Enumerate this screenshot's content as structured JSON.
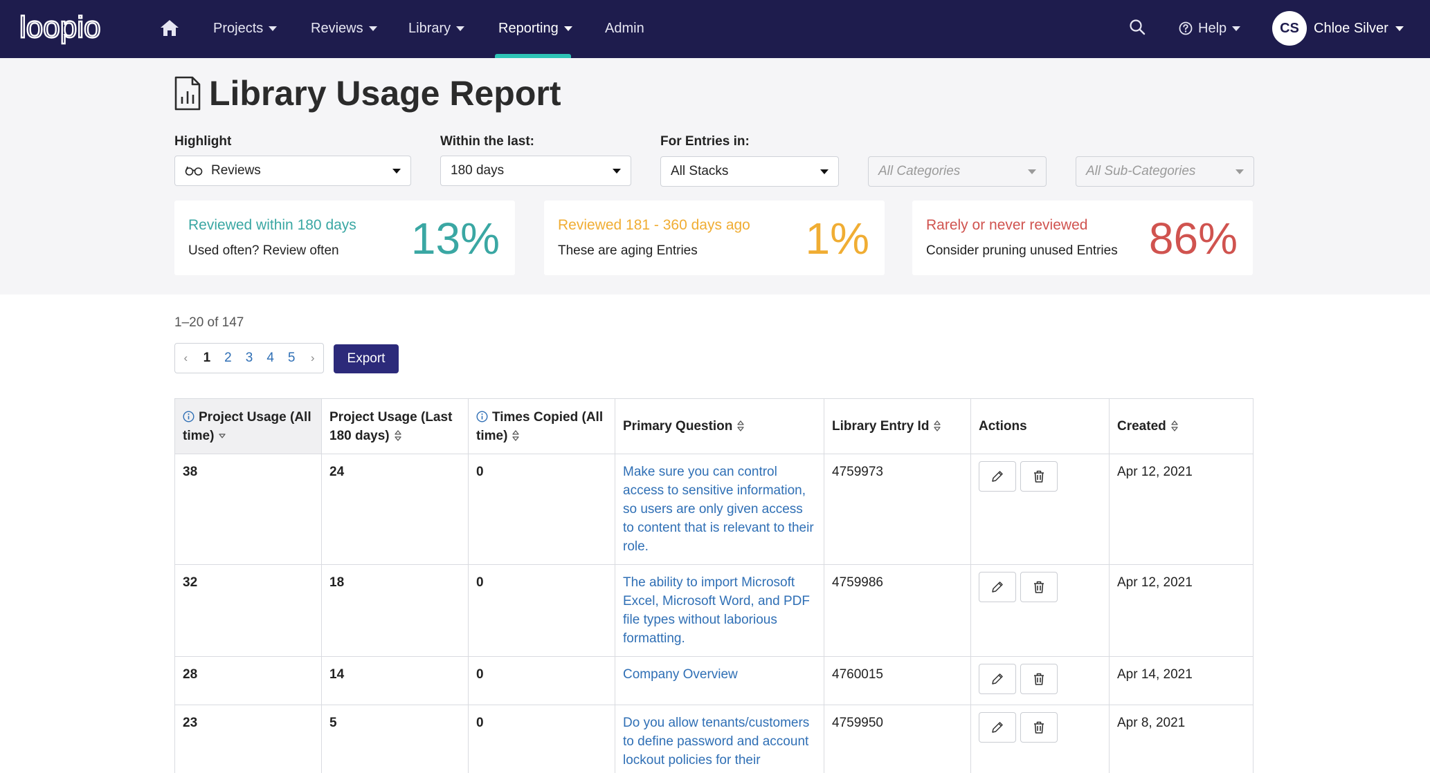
{
  "nav": {
    "logo_text": "loopio",
    "items": [
      {
        "label": "Projects"
      },
      {
        "label": "Reviews"
      },
      {
        "label": "Library"
      },
      {
        "label": "Reporting"
      },
      {
        "label": "Admin"
      }
    ],
    "active": "Reporting",
    "help_label": "Help",
    "user_initials": "CS",
    "user_name": "Chloe Silver"
  },
  "page": {
    "title": "Library Usage Report"
  },
  "filters": {
    "highlight_label": "Highlight",
    "highlight_value": "Reviews",
    "within_label": "Within the last:",
    "within_value": "180 days",
    "entries_label": "For Entries in:",
    "stacks_value": "All Stacks",
    "categories_value": "All Categories",
    "subcategories_value": "All Sub-Categories"
  },
  "cards": [
    {
      "title": "Reviewed within 180 days",
      "subtitle": "Used often? Review often",
      "percent": "13%",
      "color": "#3aa7a3"
    },
    {
      "title": "Reviewed 181 - 360 days ago",
      "subtitle": "These are aging Entries",
      "percent": "1%",
      "color": "#f0ad33"
    },
    {
      "title": "Rarely or never reviewed",
      "subtitle": "Consider pruning unused Entries",
      "percent": "86%",
      "color": "#d0534f"
    }
  ],
  "results": {
    "range_text": "1–20 of 147",
    "pages": [
      "1",
      "2",
      "3",
      "4",
      "5"
    ],
    "prev": "‹",
    "next": "›",
    "export_label": "Export"
  },
  "table": {
    "headers": {
      "usage_all": "Project Usage (All time)",
      "usage_180": "Project Usage (Last 180 days)",
      "copied": "Times Copied (All time)",
      "question": "Primary Question",
      "entry_id": "Library Entry Id",
      "actions": "Actions",
      "created": "Created"
    },
    "rows": [
      {
        "usage_all": "38",
        "usage_180": "24",
        "copied": "0",
        "question": "Make sure you can control access to sensitive information, so users are only given access to content that is relevant to their role.",
        "entry_id": "4759973",
        "created": "Apr 12, 2021"
      },
      {
        "usage_all": "32",
        "usage_180": "18",
        "copied": "0",
        "question": "The ability to import Microsoft Excel, Microsoft Word, and PDF file types without laborious formatting.",
        "entry_id": "4759986",
        "created": "Apr 12, 2021"
      },
      {
        "usage_all": "28",
        "usage_180": "14",
        "copied": "0",
        "question": "Company Overview",
        "entry_id": "4760015",
        "created": "Apr 14, 2021"
      },
      {
        "usage_all": "23",
        "usage_180": "5",
        "copied": "0",
        "question": "Do you allow tenants/customers to define password and account lockout policies for their accounts?",
        "entry_id": "4759950",
        "created": "Apr 8, 2021"
      }
    ]
  },
  "colors": {
    "nav_bg": "#1e1c4d",
    "accent": "#2ec4b6",
    "link": "#2f6fb5",
    "button": "#2c2a7a"
  }
}
